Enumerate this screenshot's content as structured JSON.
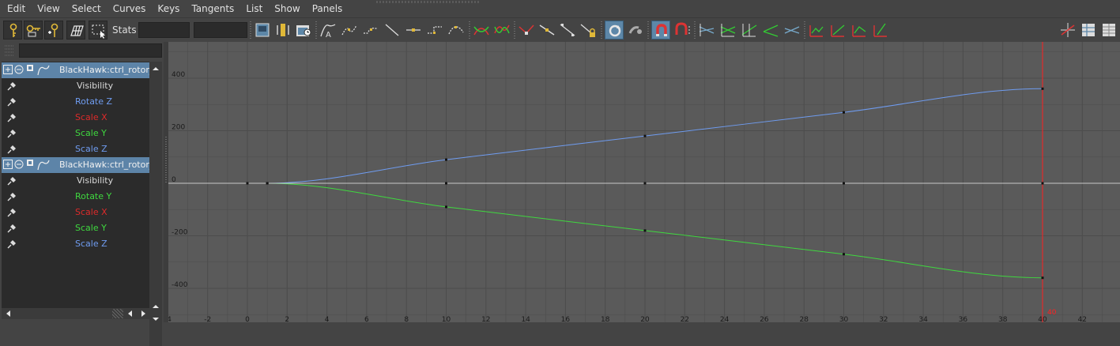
{
  "menu": [
    "Edit",
    "View",
    "Select",
    "Curves",
    "Keys",
    "Tangents",
    "List",
    "Show",
    "Panels"
  ],
  "toolbar": {
    "stats_label": "Stats",
    "stats_field_1": "",
    "stats_field_2": "",
    "buttons": [
      "move-key-icon",
      "insert-key-icon",
      "add-key-icon",
      "lattice-deform-icon",
      "region-select-icon",
      "frame-all-icon",
      "frame-playback-icon",
      "center-current-time-icon",
      "auto-tangent-icon",
      "spline-tangent-icon",
      "clamped-tangent-icon",
      "linear-tangent-icon",
      "flat-tangent-icon",
      "step-tangent-icon",
      "plateau-tangent-icon",
      "buffer-curve-snapshot-icon",
      "swap-buffer-curve-icon",
      "break-tangents-icon",
      "unify-tangents-icon",
      "free-tangent-weight-icon",
      "lock-tangent-weight-icon",
      "auto-load-icon",
      "time-snap-icon",
      "value-snap-icon",
      "magnet-icon",
      "isolate-curve-icon",
      "stacked-curves-icon",
      "normalize-curves-icon",
      "denormalize-curves-icon",
      "pre-infinity-cycle-icon",
      "post-infinity-cycle-icon",
      "cycle-offset-icon",
      "oscillate-icon",
      "dope-sheet-icon",
      "trax-editor-icon",
      "channel-box-icon"
    ]
  },
  "outliner": {
    "filter_value": "",
    "groups": [
      {
        "name": "BlackHawk:ctrl_rotor_main",
        "attributes": [
          {
            "label": "Visibility",
            "color": "#d8d8d8"
          },
          {
            "label": "Rotate Z",
            "color": "#6f9cf0"
          },
          {
            "label": "Scale X",
            "color": "#dd2a2a"
          },
          {
            "label": "Scale Y",
            "color": "#3fd83f"
          },
          {
            "label": "Scale Z",
            "color": "#6f9cf0"
          }
        ]
      },
      {
        "name": "BlackHawk:ctrl_rotor_rear",
        "attributes": [
          {
            "label": "Visibility",
            "color": "#d8d8d8"
          },
          {
            "label": "Rotate Y",
            "color": "#3fd83f"
          },
          {
            "label": "Scale X",
            "color": "#dd2a2a"
          },
          {
            "label": "Scale Y",
            "color": "#3fd83f"
          },
          {
            "label": "Scale Z",
            "color": "#6f9cf0"
          }
        ]
      }
    ]
  },
  "graph": {
    "current_time": 40,
    "current_time_label": "40",
    "colors": {
      "background": "#5a5a5a",
      "grid": "#4c4c4c",
      "zero_line": "#c8c8c8",
      "time_cursor": "#ff2020",
      "curve_rotate_z": "#6f9cf0",
      "curve_rotate_y": "#3fd83f"
    }
  },
  "chart_data": {
    "type": "line",
    "xlabel": "",
    "ylabel": "",
    "xlim": [
      -4,
      43
    ],
    "ylim": [
      -460,
      490
    ],
    "x_ticks": [
      -4,
      -2,
      0,
      2,
      4,
      6,
      8,
      10,
      12,
      14,
      16,
      18,
      20,
      22,
      24,
      26,
      28,
      30,
      32,
      34,
      36,
      38,
      40,
      42
    ],
    "y_ticks": [
      400,
      200,
      0,
      -200,
      -400
    ],
    "series": [
      {
        "color": "#6f9cf0",
        "keys_x": [
          1,
          10,
          20,
          30,
          40
        ],
        "keys_y": [
          0,
          90,
          180,
          270,
          360
        ]
      },
      {
        "color": "#3fd83f",
        "keys_x": [
          1,
          10,
          20,
          30,
          40
        ],
        "keys_y": [
          0,
          -90,
          -180,
          -270,
          -360
        ]
      },
      {
        "color": "#c8c8c8",
        "keys_x": [
          0,
          10,
          20,
          30,
          40
        ],
        "keys_y": [
          0,
          0,
          0,
          0,
          0
        ]
      }
    ]
  }
}
